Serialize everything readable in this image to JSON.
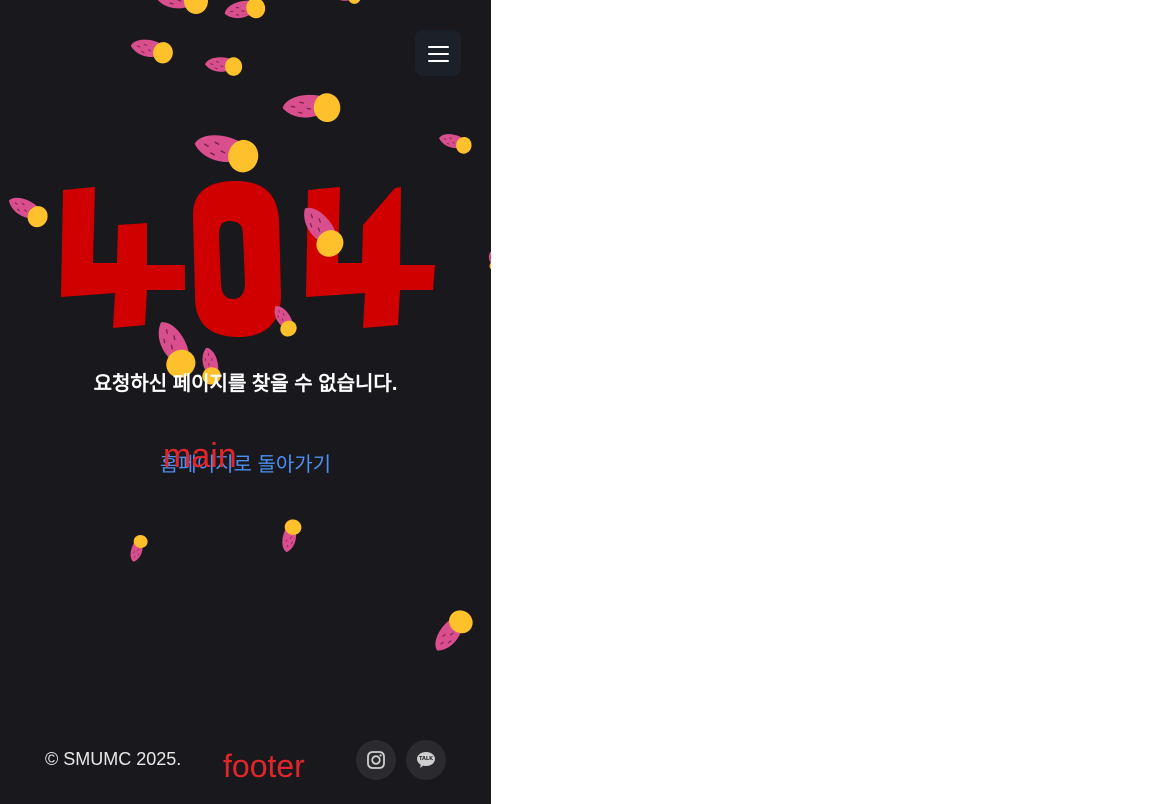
{
  "header": {
    "menu_icon": "hamburger-icon"
  },
  "error": {
    "code": "404",
    "message": "요청하신 페이지를 찾을 수 없습니다.",
    "home_link": "홈페이지로 돌아가기",
    "overlay_label": "main"
  },
  "footer": {
    "copyright": "© SMUMC 2025.",
    "overlay_label": "footer",
    "instagram_icon": "instagram-icon",
    "kakao_icon": "kakaotalk-icon",
    "kakao_badge": "TALK"
  },
  "colors": {
    "background": "#19181d",
    "accent_red": "#d10000",
    "link_blue": "#4d8ff1",
    "potato_skin": "#d94f8d",
    "potato_flesh": "#fec12b"
  }
}
